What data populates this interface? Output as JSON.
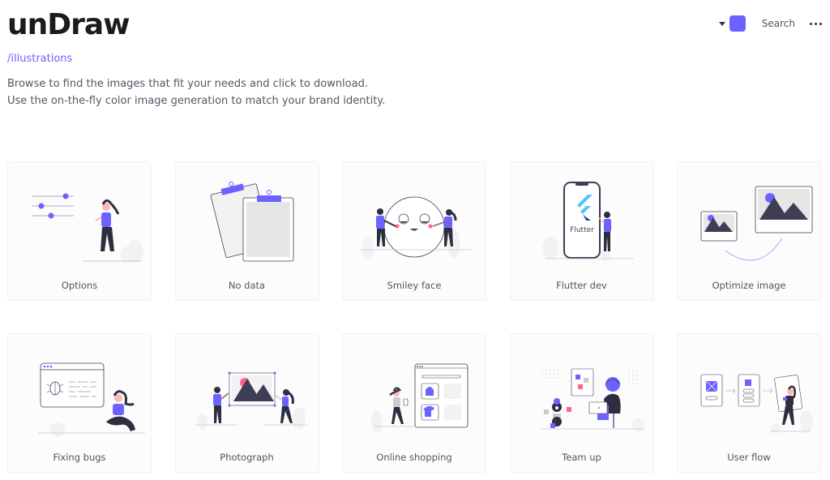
{
  "header": {
    "logo": "unDraw",
    "sublink": "/illustrations",
    "intro": "Browse to find the images that fit your needs and click to download. Use the on-the-fly color image generation to match your brand identity."
  },
  "nav": {
    "color_picker_icon": "caret-down-icon",
    "accent_color": "#6c63ff",
    "search_label": "Search",
    "more_icon": "more-horizontal-icon"
  },
  "colors": {
    "accent": "#6c63ff",
    "dark": "#3f3d56",
    "pink": "#ff6584",
    "flutter_light": "#54c5f8",
    "flutter_dark": "#01579b"
  },
  "illustrations": [
    {
      "title": "Options"
    },
    {
      "title": "No data"
    },
    {
      "title": "Smiley face"
    },
    {
      "title": "Flutter dev",
      "inner_text": "Flutter"
    },
    {
      "title": "Optimize image"
    },
    {
      "title": "Fixing bugs"
    },
    {
      "title": "Photograph"
    },
    {
      "title": "Online shopping"
    },
    {
      "title": "Team up"
    },
    {
      "title": "User flow"
    }
  ]
}
